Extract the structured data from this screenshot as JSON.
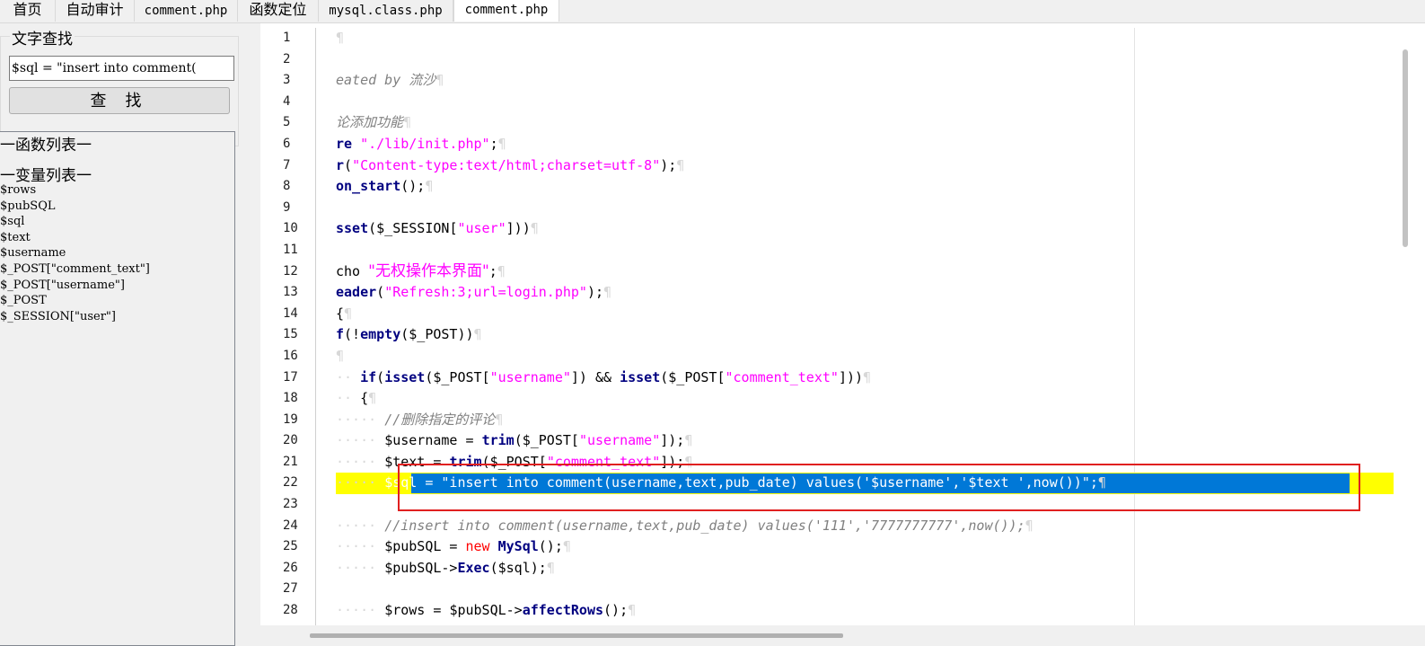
{
  "tabs": [
    {
      "label": "首页"
    },
    {
      "label": "自动审计"
    },
    {
      "label": "comment.php"
    },
    {
      "label": "函数定位"
    },
    {
      "label": "mysql.class.php"
    },
    {
      "label": "comment.php"
    }
  ],
  "search": {
    "group_title": "文字查找",
    "input_value": "$sql = \"insert into comment(",
    "button_label": "查 找"
  },
  "lists": {
    "functions_header": "一函数列表一",
    "variables_header": "一变量列表一",
    "variables": [
      "$rows",
      "$pubSQL",
      "$sql",
      "$text",
      "$username",
      "$_POST[\"comment_text\"]",
      "$_POST[\"username\"]",
      "$_POST",
      "$_SESSION[\"user\"]"
    ]
  },
  "editor": {
    "line_numbers": [
      "1",
      "2",
      "3",
      "4",
      "5",
      "6",
      "7",
      "8",
      "9",
      "10",
      "11",
      "12",
      "13",
      "14",
      "15",
      "16",
      "17",
      "18",
      "19",
      "20",
      "21",
      "22",
      "23",
      "24",
      "25",
      "26",
      "27",
      "28"
    ],
    "pilcrow": "¶",
    "code": {
      "l3": "eated by 流沙",
      "l5": "论添加功能",
      "l6_kw": "re",
      "l6_str": "\"./lib/init.php\"",
      "l7_kw": "r",
      "l7_str": "\"Content-type:text/html;charset=utf-8\"",
      "l8_kw": "on_start",
      "l10_kw": "sset",
      "l10_var": "$_SESSION",
      "l10_str": "\"user\"",
      "l12_kw": "cho",
      "l12_str": "\"无权操作本界面\"",
      "l13_kw": "eader",
      "l13_str": "\"Refresh:3;url=login.php\"",
      "l14": "{",
      "l15_kw1": "f",
      "l15_kw2": "empty",
      "l15_var": "$_POST",
      "l17_kw1": "if",
      "l17_kw2": "isset",
      "l17_var1": "$_POST",
      "l17_str1": "\"username\"",
      "l17_kw3": "isset",
      "l17_var2": "$_POST",
      "l17_str2": "\"comment_text\"",
      "l18": "{",
      "l19": "//删除指定的评论",
      "l20_var1": "$username",
      "l20_kw": "trim",
      "l20_var2": "$_POST",
      "l20_str": "\"username\"",
      "l21_var1": "$text",
      "l21_kw": "trim",
      "l21_var2": "$_POST",
      "l21_str": "\"comment_text\"",
      "l22": "$sql = \"insert into comment(username,text,pub_date) values('$username','$text ',now())\";",
      "l24": "//insert into comment(username,text,pub_date) values('111','7777777777',now());",
      "l25_var": "$pubSQL",
      "l25_new": "new",
      "l25_cls": "MySql",
      "l26_var1": "$pubSQL->",
      "l26_kw": "Exec",
      "l26_var2": "$sql",
      "l28_var1": "$rows",
      "l28_var2": "$pubSQL->",
      "l28_kw": "affectRows"
    }
  }
}
